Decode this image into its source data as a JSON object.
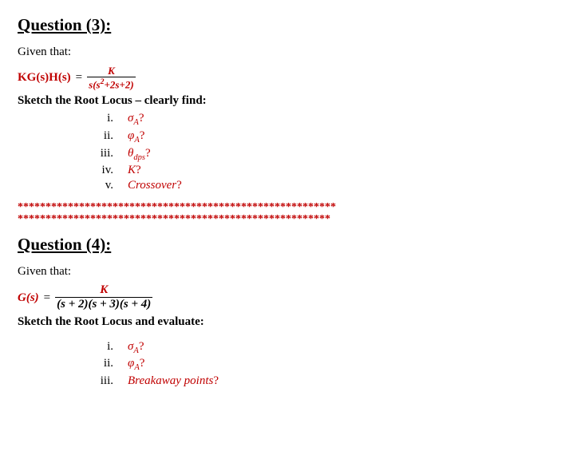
{
  "q3": {
    "heading": "Question (3):",
    "given": "Given that:",
    "lhs": "KG(s)H(s)",
    "eq": "=",
    "num": "K",
    "den_pre": "s(s",
    "den_exp": "2",
    "den_post": "+2s+2)",
    "instr": "Sketch the Root Locus – clearly find:",
    "items": [
      {
        "n": "i.",
        "sym_main": "σ",
        "sym_sub": "A",
        "tail": "?"
      },
      {
        "n": "ii.",
        "sym_main": "φ",
        "sym_sub": "A",
        "tail": "?"
      },
      {
        "n": "iii.",
        "sym_main": "θ",
        "sym_sub": "dps",
        "tail": "?"
      },
      {
        "n": "iv.",
        "sym_main": "K",
        "sym_sub": "",
        "tail": "?"
      },
      {
        "n": "v.",
        "sym_main": "Crossover",
        "sym_sub": "",
        "tail": "?"
      }
    ]
  },
  "sep1": "*********************************************************",
  "sep2": "********************************************************",
  "q4": {
    "heading": "Question (4):",
    "given": "Given that:",
    "lhs": "G(s)",
    "eq": "=",
    "num": "K",
    "den": "(s + 2)(s + 3)(s + 4)",
    "instr": "Sketch the Root Locus  and evaluate:",
    "items": [
      {
        "n": "i.",
        "sym_main": "σ",
        "sym_sub": "A",
        "tail": "?"
      },
      {
        "n": "ii.",
        "sym_main": "φ",
        "sym_sub": "A",
        "tail": "?"
      },
      {
        "n": "iii.",
        "sym_main": "Breakaway points",
        "sym_sub": "",
        "tail": "?"
      }
    ]
  }
}
